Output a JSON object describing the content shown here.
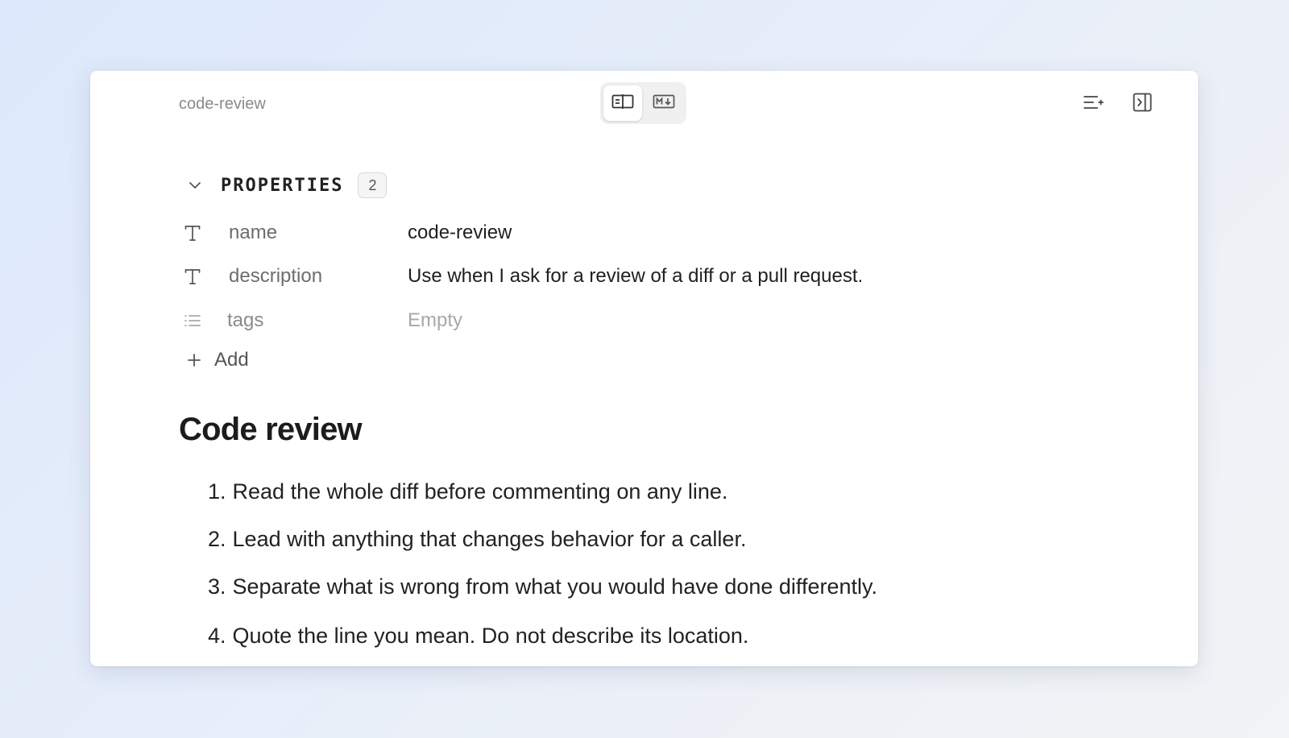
{
  "window": {
    "doc_title": "code-review"
  },
  "toolbar": {
    "view_modes": [
      {
        "icon": "reading-view-icon",
        "active": true
      },
      {
        "icon": "markdown-source-icon",
        "active": false
      }
    ],
    "right_icons": [
      "outline-icon",
      "sidebar-toggle-icon"
    ]
  },
  "properties": {
    "header_label": "PROPERTIES",
    "count": "2",
    "rows": [
      {
        "type": "text",
        "icon": "text-type-icon",
        "key": "name",
        "value": "code-review",
        "empty": false
      },
      {
        "type": "text",
        "icon": "text-type-icon",
        "key": "description",
        "value": "Use when I ask for a review of a diff or a pull request.",
        "empty": false
      },
      {
        "type": "list",
        "icon": "list-type-icon",
        "key": "tags",
        "value": "Empty",
        "empty": true
      }
    ],
    "add_label": "Add"
  },
  "content": {
    "heading": "Code review",
    "list_items": [
      {
        "num": "1.",
        "text": "Read the whole diff before commenting on any line."
      },
      {
        "num": "2.",
        "text": "Lead with anything that changes behavior for a caller."
      },
      {
        "num": "3.",
        "text": "Separate what is wrong from what you would have done differently."
      },
      {
        "num": "4.",
        "text": "Quote the line you mean. Do not describe its location."
      }
    ]
  }
}
